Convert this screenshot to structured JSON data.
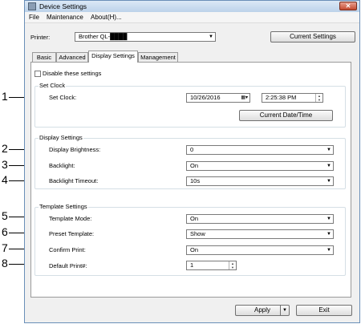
{
  "window": {
    "title": "Device Settings",
    "close_label": "✕"
  },
  "menu": {
    "file": "File",
    "maintenance": "Maintenance",
    "about": "About(H)..."
  },
  "printer": {
    "label": "Printer:",
    "value": "Brother QL-████",
    "current_settings_button": "Current Settings"
  },
  "tabs": [
    {
      "label": "Basic"
    },
    {
      "label": "Advanced"
    },
    {
      "label": "Display Settings",
      "active": true
    },
    {
      "label": "Management"
    }
  ],
  "disable_settings": {
    "label": "Disable these settings",
    "checked": false
  },
  "set_clock": {
    "group_title": "Set Clock",
    "label": "Set Clock:",
    "date": "10/26/2016",
    "time": "2:25:38 PM",
    "current_date_button": "Current Date/Time"
  },
  "display_settings": {
    "group_title": "Display Settings",
    "brightness_label": "Display Brightness:",
    "brightness_value": "0",
    "backlight_label": "Backlight:",
    "backlight_value": "On",
    "timeout_label": "Backlight Timeout:",
    "timeout_value": "10s"
  },
  "template_settings": {
    "group_title": "Template Settings",
    "mode_label": "Template Mode:",
    "mode_value": "On",
    "preset_label": "Preset Template:",
    "preset_value": "Show",
    "confirm_label": "Confirm Print:",
    "confirm_value": "On",
    "default_label": "Default Print#:",
    "default_value": "1"
  },
  "footer": {
    "apply_button": "Apply",
    "exit_button": "Exit"
  },
  "callouts": [
    "1",
    "2",
    "3",
    "4",
    "5",
    "6",
    "7",
    "8"
  ],
  "colors": {
    "titlebar": "#bcd2ea",
    "close": "#c44a30",
    "panel_border": "#9a9a9a",
    "group_border": "#d5dfe5"
  }
}
